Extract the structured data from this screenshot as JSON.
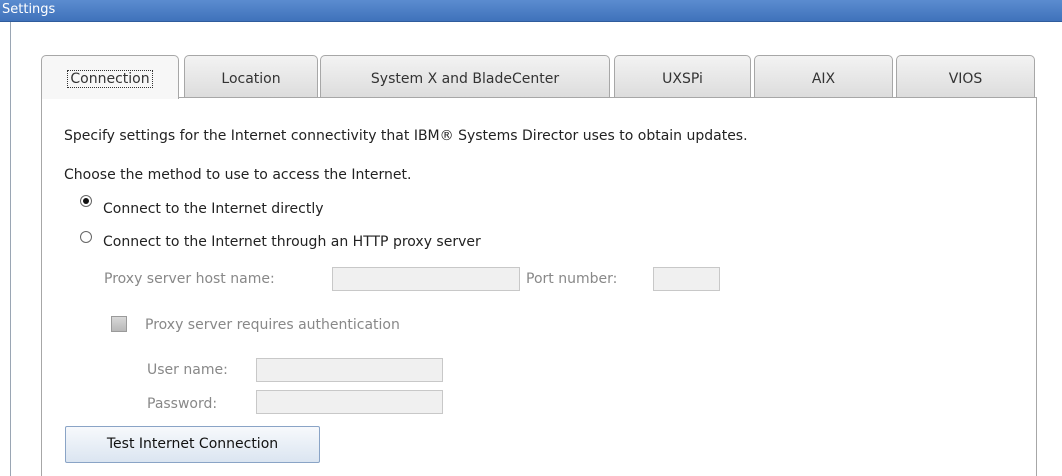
{
  "window": {
    "title": "Settings"
  },
  "tabs": [
    {
      "label": "Connection",
      "active": true
    },
    {
      "label": "Location",
      "active": false
    },
    {
      "label": "System X and BladeCenter",
      "active": false
    },
    {
      "label": "UXSPi",
      "active": false
    },
    {
      "label": "AIX",
      "active": false
    },
    {
      "label": "VIOS",
      "active": false
    }
  ],
  "connection": {
    "description": "Specify settings for the Internet connectivity that IBM® Systems Director uses to obtain updates.",
    "method_prompt": "Choose the method to use to access the Internet.",
    "options": [
      {
        "label": "Connect to the Internet directly",
        "selected": true
      },
      {
        "label": "Connect to the Internet through an HTTP proxy server",
        "selected": false
      }
    ],
    "proxy": {
      "host_label": "Proxy server host name:",
      "host_value": "",
      "port_label": "Port number:",
      "port_value": "",
      "auth_label": "Proxy server requires authentication",
      "auth_checked": false,
      "user_label": "User name:",
      "user_value": "",
      "password_label": "Password:",
      "password_value": ""
    },
    "test_button": "Test Internet Connection"
  }
}
